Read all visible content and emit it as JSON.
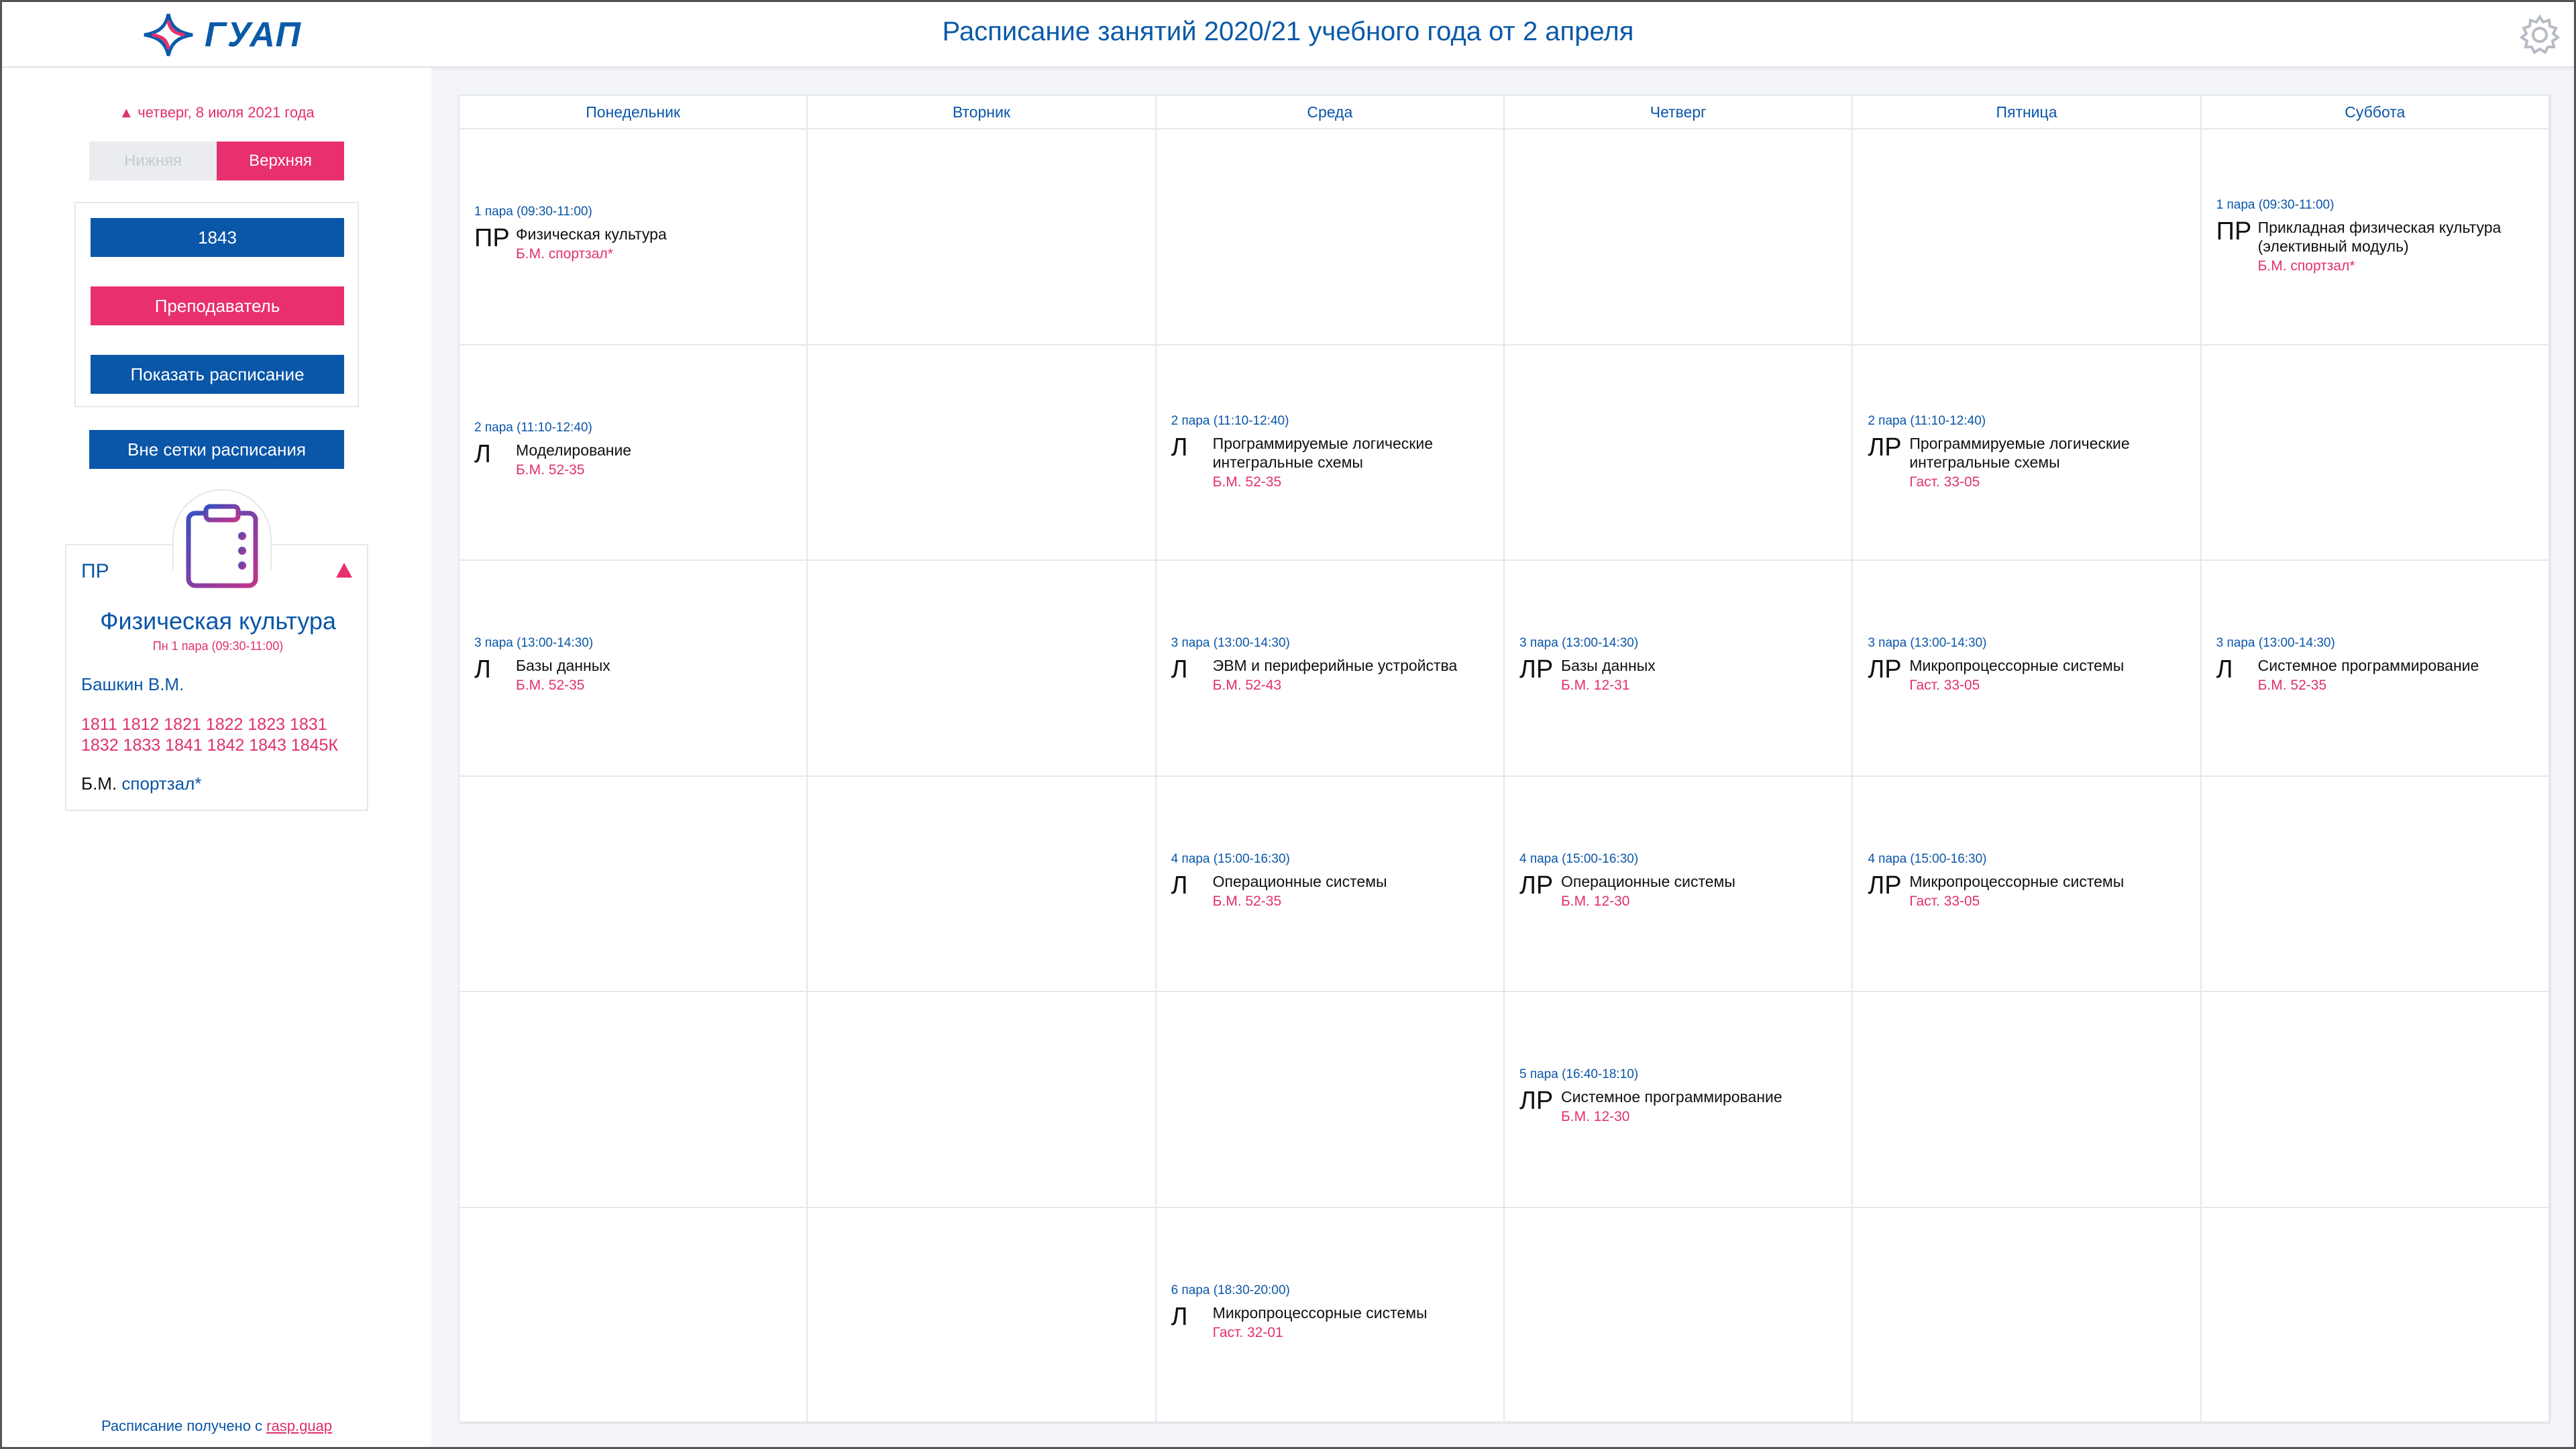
{
  "header": {
    "logo_text": "ГУАП",
    "title": "Расписание занятий 2020/21 учебного года от 2 апреля",
    "settings_icon": "gear-icon"
  },
  "sidebar": {
    "date": "▲ четверг, 8 июля 2021 года",
    "week_lower": "Нижняя",
    "week_upper": "Верхняя",
    "group": "1843",
    "teacher_btn": "Преподаватель",
    "show_btn": "Показать расписание",
    "outside_btn": "Вне сетки расписания",
    "detail": {
      "type": "ПР",
      "subject": "Физическая культура",
      "time": "Пн 1 пара (09:30-11:00)",
      "teacher": "Башкин В.М.",
      "groups": "1811 1812 1821 1822 1823 1831 1832 1833 1841 1842 1843 1845К",
      "building": "Б.М.",
      "room": "спортзал*"
    },
    "footer_text": "Расписание получено с ",
    "footer_link": "rasp.guap"
  },
  "schedule": {
    "days": [
      "Понедельник",
      "Вторник",
      "Среда",
      "Четверг",
      "Пятница",
      "Суббота"
    ],
    "lessons": [
      {
        "day": 0,
        "slot": 0,
        "time": "1 пара (09:30-11:00)",
        "kind": "ПР",
        "name": "Физическая культура",
        "room": "Б.М. спортзал*"
      },
      {
        "day": 5,
        "slot": 0,
        "time": "1 пара (09:30-11:00)",
        "kind": "ПР",
        "name": "Прикладная физическая культура (элективный модуль)",
        "room": "Б.М. спортзал*"
      },
      {
        "day": 0,
        "slot": 1,
        "time": "2 пара (11:10-12:40)",
        "kind": "Л",
        "name": "Моделирование",
        "room": "Б.М. 52-35"
      },
      {
        "day": 2,
        "slot": 1,
        "time": "2 пара (11:10-12:40)",
        "kind": "Л",
        "name": "Программируемые логические интегральные схемы",
        "room": "Б.М. 52-35"
      },
      {
        "day": 4,
        "slot": 1,
        "time": "2 пара (11:10-12:40)",
        "kind": "ЛР",
        "name": "Программируемые логические интегральные схемы",
        "room": "Гаст. 33-05"
      },
      {
        "day": 0,
        "slot": 2,
        "time": "3 пара (13:00-14:30)",
        "kind": "Л",
        "name": "Базы данных",
        "room": "Б.М. 52-35"
      },
      {
        "day": 2,
        "slot": 2,
        "time": "3 пара (13:00-14:30)",
        "kind": "Л",
        "name": "ЭВМ и периферийные устройства",
        "room": "Б.М. 52-43"
      },
      {
        "day": 3,
        "slot": 2,
        "time": "3 пара (13:00-14:30)",
        "kind": "ЛР",
        "name": "Базы данных",
        "room": "Б.М. 12-31"
      },
      {
        "day": 4,
        "slot": 2,
        "time": "3 пара (13:00-14:30)",
        "kind": "ЛР",
        "name": "Микропроцессорные системы",
        "room": "Гаст. 33-05"
      },
      {
        "day": 5,
        "slot": 2,
        "time": "3 пара (13:00-14:30)",
        "kind": "Л",
        "name": "Системное программирование",
        "room": "Б.М. 52-35"
      },
      {
        "day": 2,
        "slot": 3,
        "time": "4 пара (15:00-16:30)",
        "kind": "Л",
        "name": "Операционные системы",
        "room": "Б.М. 52-35"
      },
      {
        "day": 3,
        "slot": 3,
        "time": "4 пара (15:00-16:30)",
        "kind": "ЛР",
        "name": "Операционные системы",
        "room": "Б.М. 12-30"
      },
      {
        "day": 4,
        "slot": 3,
        "time": "4 пара (15:00-16:30)",
        "kind": "ЛР",
        "name": "Микропроцессорные системы",
        "room": "Гаст. 33-05"
      },
      {
        "day": 3,
        "slot": 4,
        "time": "5 пара (16:40-18:10)",
        "kind": "ЛР",
        "name": "Системное программирование",
        "room": "Б.М. 12-30"
      },
      {
        "day": 2,
        "slot": 5,
        "time": "6 пара (18:30-20:00)",
        "kind": "Л",
        "name": "Микропроцессорные системы",
        "room": "Гаст. 32-01"
      }
    ]
  }
}
